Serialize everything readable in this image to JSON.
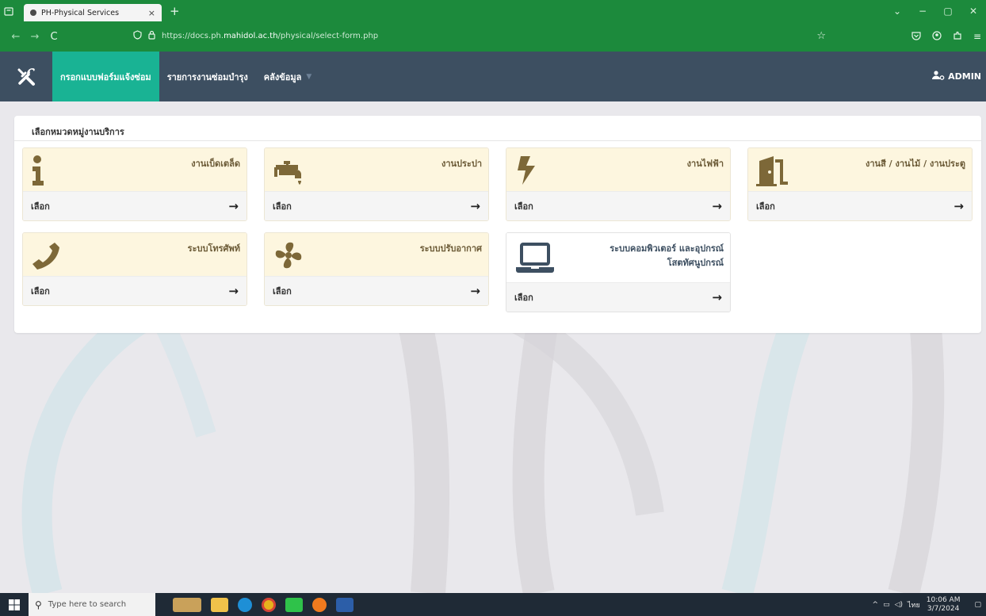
{
  "browser": {
    "tab_title": "PH-Physical Services",
    "tab_close": "×",
    "new_tab": "+",
    "url_prefix": "https://docs.ph.",
    "url_domain": "mahidol.ac.th",
    "url_path": "/physical/select-form.php",
    "controls": {
      "minimize": "−",
      "maximize": "▢",
      "close": "✕",
      "list": "⌄"
    }
  },
  "appnav": {
    "items": [
      {
        "label": "กรอกแบบฟอร์มแจ้งซ่อม",
        "active": true
      },
      {
        "label": "รายการงานซ่อมบำรุง",
        "active": false
      },
      {
        "label": "คลังข้อมูล",
        "active": false,
        "dropdown": true
      }
    ],
    "user": "ADMIN"
  },
  "panel": {
    "title": "เลือกหมวดหมู่งานบริการ",
    "select_label": "เลือก",
    "cards": [
      {
        "label": "งานเบ็ดเตล็ด",
        "icon": "info-icon"
      },
      {
        "label": "งานประปา",
        "icon": "faucet-icon"
      },
      {
        "label": "งานไฟฟ้า",
        "icon": "bolt-icon"
      },
      {
        "label": "งานสี / งานไม้ / งานประตู",
        "icon": "door-icon"
      },
      {
        "label": "ระบบโทรศัพท์",
        "icon": "phone-icon"
      },
      {
        "label": "ระบบปรับอากาศ",
        "icon": "fan-icon"
      },
      {
        "label_line1": "ระบบคอมพิวเตอร์ และอุปกรณ์",
        "label_line2": "โสตทัศนูปกรณ์",
        "icon": "laptop-icon"
      }
    ]
  },
  "taskbar": {
    "search_placeholder": "Type here to search",
    "time": "10:06 AM",
    "date": "3/7/2024",
    "lang": "ไทย"
  },
  "colors": {
    "browser_green": "#1c8a3c",
    "navbar": "#3d4f61",
    "active_nav": "#19b394",
    "card_top": "#fdf6df",
    "icon_brown": "#7d6838"
  }
}
